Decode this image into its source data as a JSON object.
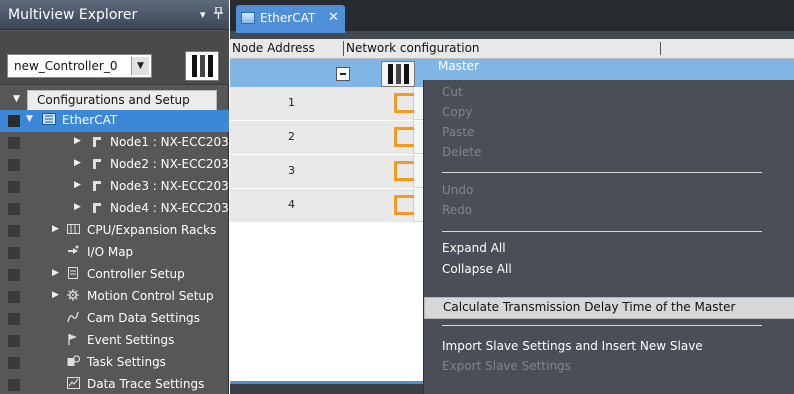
{
  "explorer": {
    "title": "Multiview Explorer",
    "pin_icon": "▾",
    "pin_label": "ᵖ",
    "controller_select": {
      "value": "new_Controller_0",
      "button": "▼"
    },
    "tree": [
      {
        "label": "Configurations and Setup",
        "level": 0,
        "expanded": true
      },
      {
        "label": "EtherCAT",
        "level": 1,
        "expanded": true,
        "selected": true
      },
      {
        "label": "Node1 : NX-ECC203",
        "level": 2
      },
      {
        "label": "Node2 : NX-ECC203",
        "level": 2
      },
      {
        "label": "Node3 : NX-ECC203",
        "level": 2
      },
      {
        "label": "Node4 : NX-ECC203",
        "level": 2
      },
      {
        "label": "CPU/Expansion Racks",
        "level": 1
      },
      {
        "label": "I/O Map",
        "level": 1
      },
      {
        "label": "Controller Setup",
        "level": 1
      },
      {
        "label": "Motion Control Setup",
        "level": 1
      },
      {
        "label": "Cam Data Settings",
        "level": 1
      },
      {
        "label": "Event Settings",
        "level": 1
      },
      {
        "label": "Task Settings",
        "level": 1
      },
      {
        "label": "Data Trace Settings",
        "level": 1
      }
    ]
  },
  "editor": {
    "tab": {
      "label": "EtherCAT",
      "close": "✕"
    },
    "grid": {
      "col_node_address": "Node Address",
      "col_network": "Network configuration",
      "master_label": "Master",
      "nodes": [
        "1",
        "2",
        "3",
        "4"
      ]
    }
  },
  "context_menu": {
    "items": [
      {
        "label": "Cut",
        "enabled": false
      },
      {
        "label": "Copy",
        "enabled": false
      },
      {
        "label": "Paste",
        "enabled": false
      },
      {
        "label": "Delete",
        "enabled": false
      },
      {
        "label": "Undo",
        "enabled": false
      },
      {
        "label": "Redo",
        "enabled": false
      },
      {
        "label": "Expand All",
        "enabled": true
      },
      {
        "label": "Collapse All",
        "enabled": true
      },
      {
        "label": "Calculate Transmission Delay Time of the Master",
        "enabled": true,
        "highlighted": true
      },
      {
        "label": "Import Slave Settings and Insert New Slave",
        "enabled": true
      },
      {
        "label": "Export Slave Settings",
        "enabled": false
      }
    ]
  },
  "colors": {
    "selection_blue": "#3b88d8",
    "master_row_blue": "#7fb6e6",
    "network_orange": "#f39a21",
    "menu_bg": "#4a4f57"
  }
}
